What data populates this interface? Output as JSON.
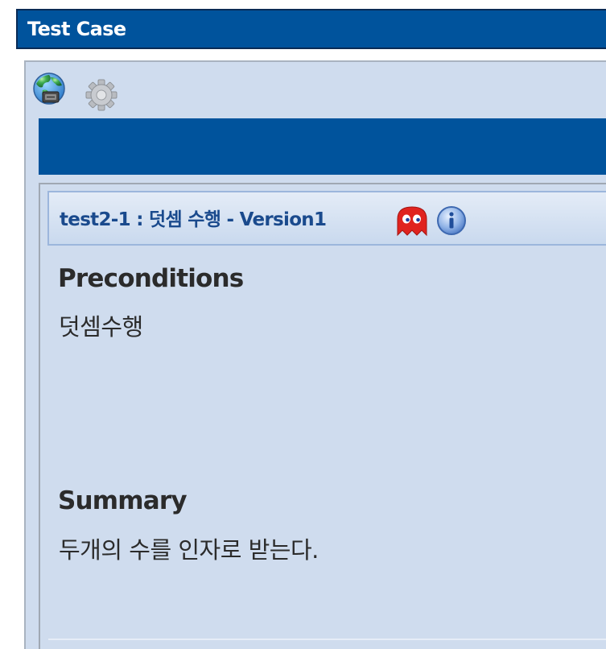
{
  "window": {
    "title": "Test Case"
  },
  "toolbar": {
    "items": [
      {
        "icon": "edit-globe-icon",
        "interactable": true
      },
      {
        "icon": "gear-icon",
        "interactable": true
      }
    ]
  },
  "testcase": {
    "title": "test2-1 : 덧셈 수행 - Version1",
    "status_icon": "ghost-icon",
    "info_icon": "info-icon"
  },
  "preconditions": {
    "heading": "Preconditions",
    "text": "덧셈수행"
  },
  "summary": {
    "heading": "Summary",
    "text": "두개의 수를 인자로 받는다."
  },
  "colors": {
    "brand_blue": "#00539c",
    "panel_bg": "#cfdcee",
    "title_text": "#1a4a8d",
    "ghost_red": "#e0231f"
  }
}
